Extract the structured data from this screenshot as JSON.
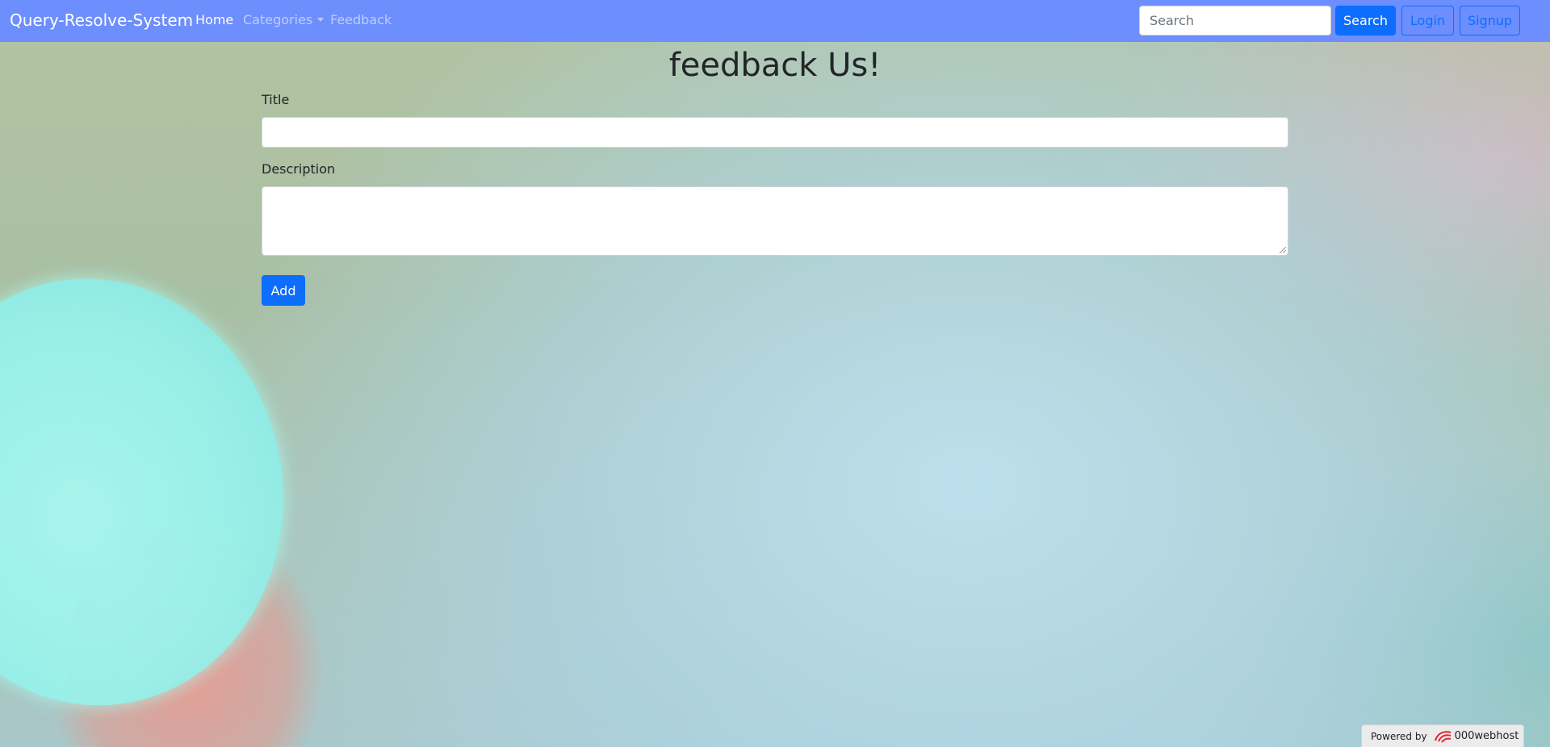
{
  "navbar": {
    "brand": "Query-Resolve-System",
    "links": [
      {
        "label": "Home",
        "active": true
      },
      {
        "label": "Categories",
        "dropdown": true
      },
      {
        "label": "Feedback"
      }
    ],
    "search": {
      "placeholder": "Search",
      "value": "",
      "button_label": "Search"
    },
    "login_label": "Login",
    "signup_label": "Signup",
    "background_color": "#6d8efd"
  },
  "main": {
    "heading": "feedback Us!",
    "form": {
      "title_label": "Title",
      "title_value": "",
      "description_label": "Description",
      "description_value": "",
      "submit_label": "Add"
    }
  },
  "footer_badge": {
    "prefix": "Powered by",
    "host_name": "000webhost",
    "icon": "000webhost-logo-icon"
  },
  "colors": {
    "primary": "#0d6efd",
    "text": "#212529"
  }
}
